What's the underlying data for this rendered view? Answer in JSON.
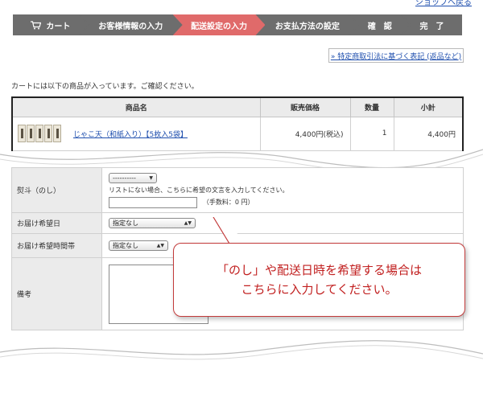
{
  "header": {
    "shop_link": "ショップへ戻る"
  },
  "steps": [
    {
      "label": "カート",
      "active": false
    },
    {
      "label": "お客様情報の入力",
      "active": false
    },
    {
      "label": "配送設定の入力",
      "active": true
    },
    {
      "label": "お支払方法の設定",
      "active": false
    },
    {
      "label": "確　認",
      "active": false
    },
    {
      "label": "完　了",
      "active": false
    }
  ],
  "legal_link": "» 特定商取引法に基づく表記 (返品など)",
  "intro": "カートには以下の商品が入っています。ご確認ください。",
  "cart_table": {
    "headers": [
      "商品名",
      "販売価格",
      "数量",
      "小計"
    ],
    "rows": [
      {
        "name": "じゃこ天（和紙入り）【5枚入5袋】",
        "price": "4,400円(税込)",
        "qty": "1",
        "subtotal": "4,400円"
      }
    ]
  },
  "options": {
    "noshi": {
      "label": "熨斗（のし）",
      "select": "----------",
      "note": "リストにない場合、こちらに希望の文言を入力してください。",
      "fee": "（手数料：0 円）"
    },
    "date": {
      "label": "お届け希望日",
      "select": "指定なし"
    },
    "time": {
      "label": "お届け希望時間帯",
      "select": "指定なし"
    },
    "memo": {
      "label": "備考"
    }
  },
  "callout": {
    "line1": "「のし」や配送日時を希望する場合は",
    "line2": "こちらに入力してください。"
  },
  "colors": {
    "active_step": "#e06a6a",
    "step": "#6d6d6d",
    "callout_text": "#c11f1f",
    "link": "#1f4fae"
  }
}
